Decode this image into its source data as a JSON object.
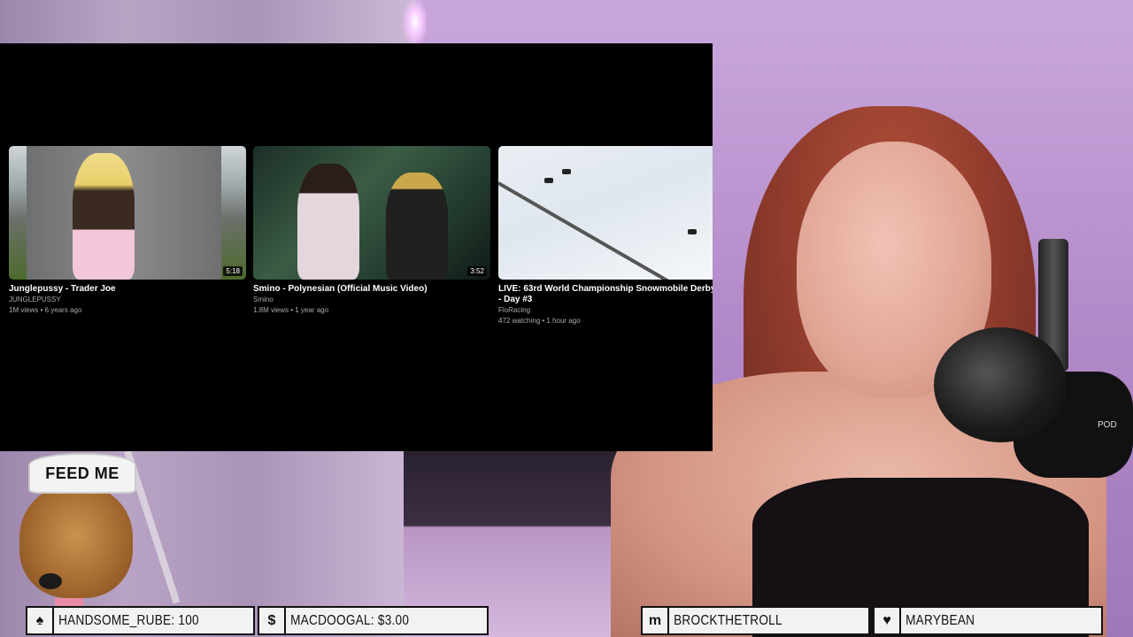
{
  "videos": [
    {
      "title": "Junglepussy - Trader Joe",
      "channel": "JUNGLEPUSSY",
      "meta": "1M views • 6 years ago",
      "duration": "5:18"
    },
    {
      "title": "Smino - Polynesian (Official Music Video)",
      "channel": "Smino",
      "meta": "1.8M views • 1 year ago",
      "duration": "3:52"
    },
    {
      "title": "LIVE: 63rd World Championship Snowmobile Derby - Day #3",
      "channel": "FloRacing",
      "meta": "472 watching • 1 hour ago",
      "duration": ""
    }
  ],
  "overlay": {
    "dog_hat_text": "FEED ME",
    "alerts": [
      {
        "icon": "spade-icon",
        "glyph": "♠",
        "text": "HANDSOME_RUBE: 100"
      },
      {
        "icon": "dollar-icon",
        "glyph": "$",
        "text": "MACDOOGAL: $3.00"
      },
      {
        "icon": "m-logo-icon",
        "glyph": "m",
        "text": "BROCKTHETROLL"
      },
      {
        "icon": "heart-icon",
        "glyph": "♥",
        "text": "MARYBEAN"
      }
    ]
  },
  "mic_label": "POD"
}
